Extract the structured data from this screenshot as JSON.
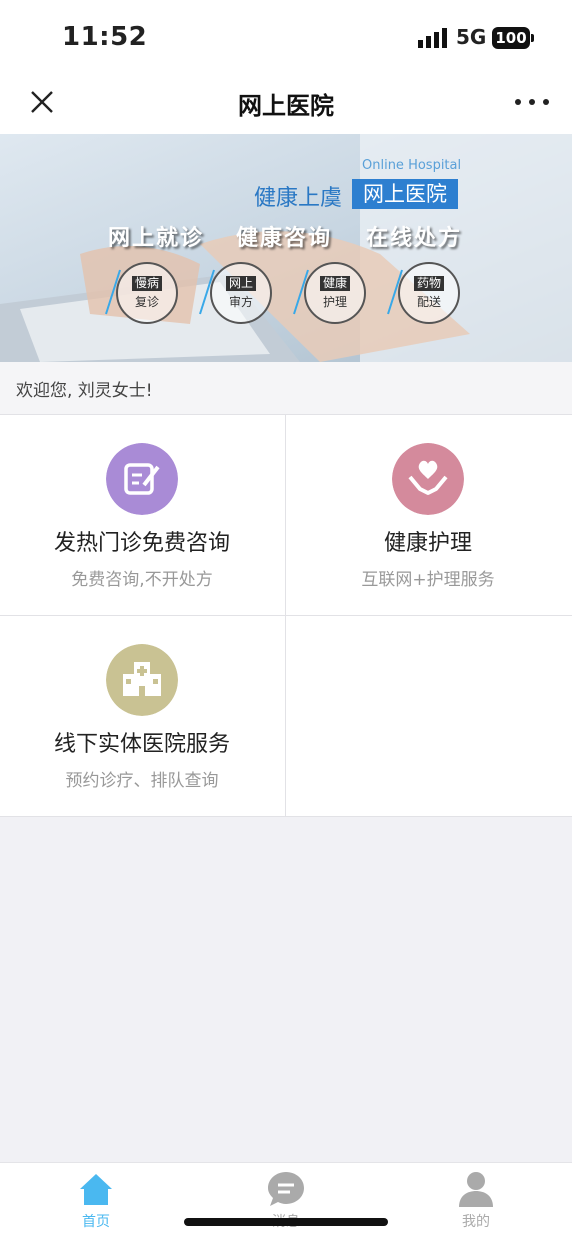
{
  "status_bar": {
    "time": "11:52",
    "network": "5G",
    "battery": "100"
  },
  "nav": {
    "title": "网上医院",
    "close_icon": "close-icon",
    "more_icon": "more-icon"
  },
  "banner": {
    "subtitle_en": "Online Hospital",
    "brand": "健康上虞",
    "badge": "网上医院",
    "slogans": [
      "网上就诊",
      "健康咨询",
      "在线处方"
    ],
    "features": [
      {
        "line1": "慢病",
        "line2": "复诊"
      },
      {
        "line1": "网上",
        "line2": "审方"
      },
      {
        "line1": "健康",
        "line2": "护理"
      },
      {
        "line1": "药物",
        "line2": "配送"
      }
    ]
  },
  "welcome": {
    "text": "欢迎您, 刘灵女士!"
  },
  "services": [
    {
      "title": "发热门诊免费咨询",
      "subtitle": "免费咨询,不开处方",
      "icon": "edit-note-icon",
      "color": "#a98bd6"
    },
    {
      "title": "健康护理",
      "subtitle": "互联网+护理服务",
      "icon": "heart-hands-icon",
      "color": "#d48a9c"
    },
    {
      "title": "线下实体医院服务",
      "subtitle": "预约诊疗、排队查询",
      "icon": "hospital-building-icon",
      "color": "#c9c293"
    }
  ],
  "tabs": [
    {
      "label": "首页",
      "icon": "home-icon",
      "active": true
    },
    {
      "label": "消息",
      "icon": "chat-icon",
      "active": false
    },
    {
      "label": "我的",
      "icon": "user-icon",
      "active": false
    }
  ],
  "colors": {
    "active_tab": "#4ab8f0",
    "inactive_tab": "#aaaaaa",
    "brand_blue": "#2d7fd0"
  }
}
